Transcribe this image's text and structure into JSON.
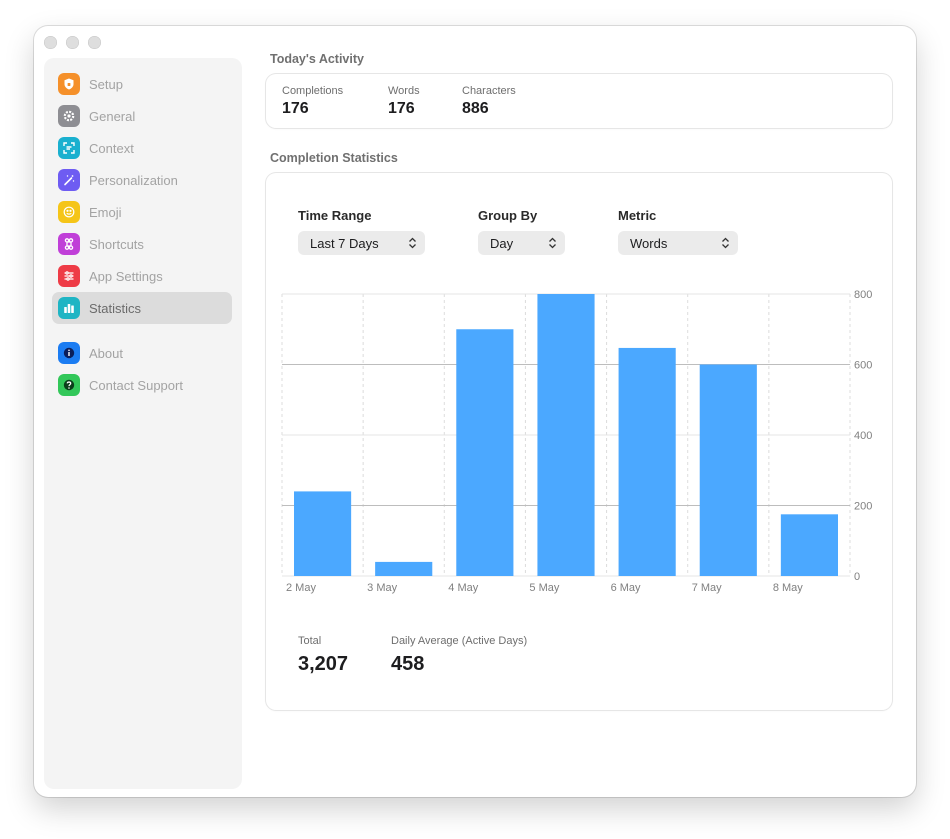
{
  "sidebar": {
    "items": [
      {
        "label": "Setup",
        "icon": "shield-icon",
        "color": "#f5902a"
      },
      {
        "label": "General",
        "icon": "gear-icon",
        "color": "#8e8e93"
      },
      {
        "label": "Context",
        "icon": "scan-icon",
        "color": "#1ab0cf"
      },
      {
        "label": "Personalization",
        "icon": "magic-wand-icon",
        "color": "#6e5cf2"
      },
      {
        "label": "Emoji",
        "icon": "smiley-icon",
        "color": "#f5c518"
      },
      {
        "label": "Shortcuts",
        "icon": "command-icon",
        "color": "#c03fd8"
      },
      {
        "label": "App Settings",
        "icon": "sliders-icon",
        "color": "#ee3b46"
      },
      {
        "label": "Statistics",
        "icon": "bar-chart-icon",
        "color": "#1fb5c4",
        "active": true
      },
      {
        "label": "About",
        "icon": "info-icon",
        "color": "#1b7cf2"
      },
      {
        "label": "Contact Support",
        "icon": "question-icon",
        "color": "#32c759"
      }
    ]
  },
  "today": {
    "title": "Today's Activity",
    "completions_label": "Completions",
    "completions_value": "176",
    "words_label": "Words",
    "words_value": "176",
    "characters_label": "Characters",
    "characters_value": "886"
  },
  "stats": {
    "title": "Completion Statistics",
    "time_range_label": "Time Range",
    "time_range_value": "Last 7 Days",
    "group_by_label": "Group By",
    "group_by_value": "Day",
    "metric_label": "Metric",
    "metric_value": "Words",
    "total_label": "Total",
    "total_value": "3,207",
    "avg_label": "Daily Average (Active Days)",
    "avg_value": "458"
  },
  "chart_data": {
    "type": "bar",
    "categories": [
      "2 May",
      "3 May",
      "4 May",
      "5 May",
      "6 May",
      "7 May",
      "8 May"
    ],
    "values": [
      240,
      40,
      700,
      800,
      647,
      600,
      175
    ],
    "ylim": [
      0,
      800
    ],
    "yticks": [
      0,
      200,
      400,
      600,
      800
    ],
    "bar_color": "#4ba8ff",
    "grid": true
  }
}
